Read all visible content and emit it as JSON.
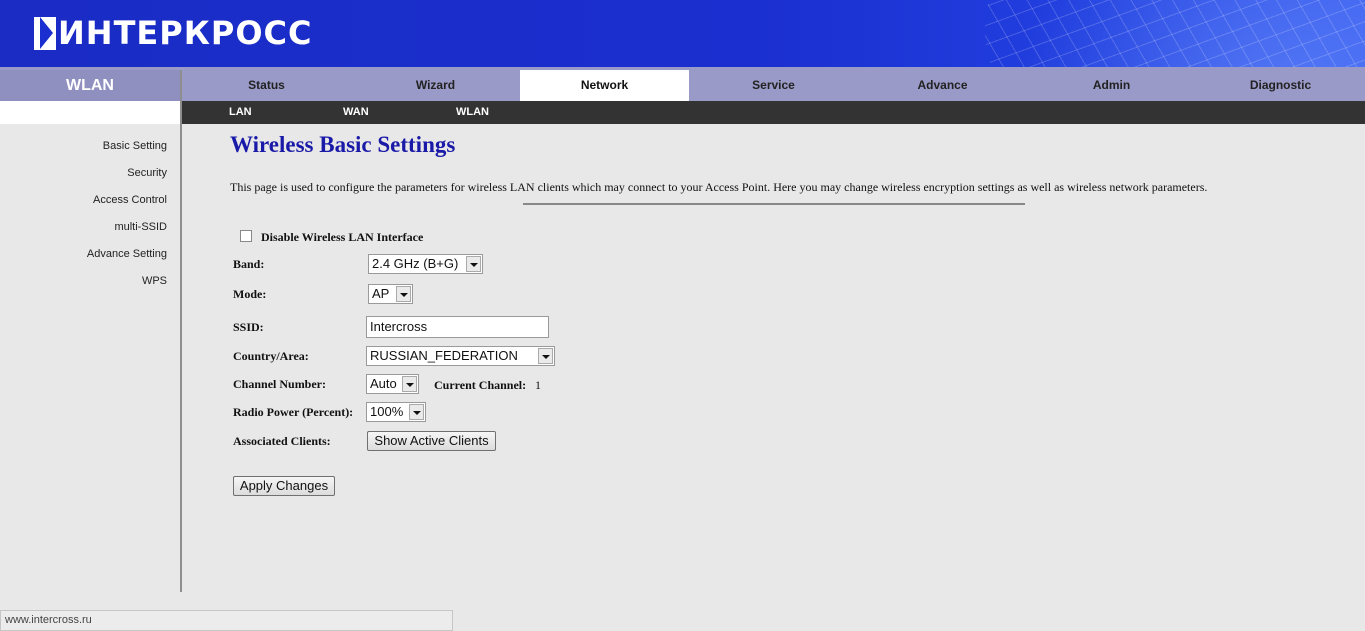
{
  "header": {
    "logo_text": "ИНТЕРКРОСС"
  },
  "sidebar": {
    "title": "WLAN",
    "items": [
      "Basic Setting",
      "Security",
      "Access Control",
      "multi-SSID",
      "Advance Setting",
      "WPS"
    ]
  },
  "tabs": [
    "Status",
    "Wizard",
    "Network",
    "Service",
    "Advance",
    "Admin",
    "Diagnostic"
  ],
  "active_tab": "Network",
  "subnav": [
    "LAN",
    "WAN",
    "WLAN"
  ],
  "main": {
    "title": "Wireless Basic Settings",
    "description": "This page is used to configure the parameters for wireless LAN clients which may connect to your Access Point. Here you may change wireless encryption settings as well as wireless network parameters.",
    "disable_label": "Disable Wireless LAN Interface",
    "band_label": "Band:",
    "band_value": "2.4 GHz (B+G)",
    "mode_label": "Mode:",
    "mode_value": "AP",
    "ssid_label": "SSID:",
    "ssid_value": "Intercross",
    "country_label": "Country/Area:",
    "country_value": "RUSSIAN_FEDERATION",
    "channel_label": "Channel Number:",
    "channel_value": "Auto",
    "current_channel_label": "Current Channel:",
    "current_channel_value": "1",
    "power_label": "Radio Power (Percent):",
    "power_value": "100%",
    "clients_label": "Associated Clients:",
    "clients_button": "Show Active Clients",
    "apply_button": "Apply Changes"
  },
  "statusbar": {
    "url": "www.intercross.ru"
  }
}
